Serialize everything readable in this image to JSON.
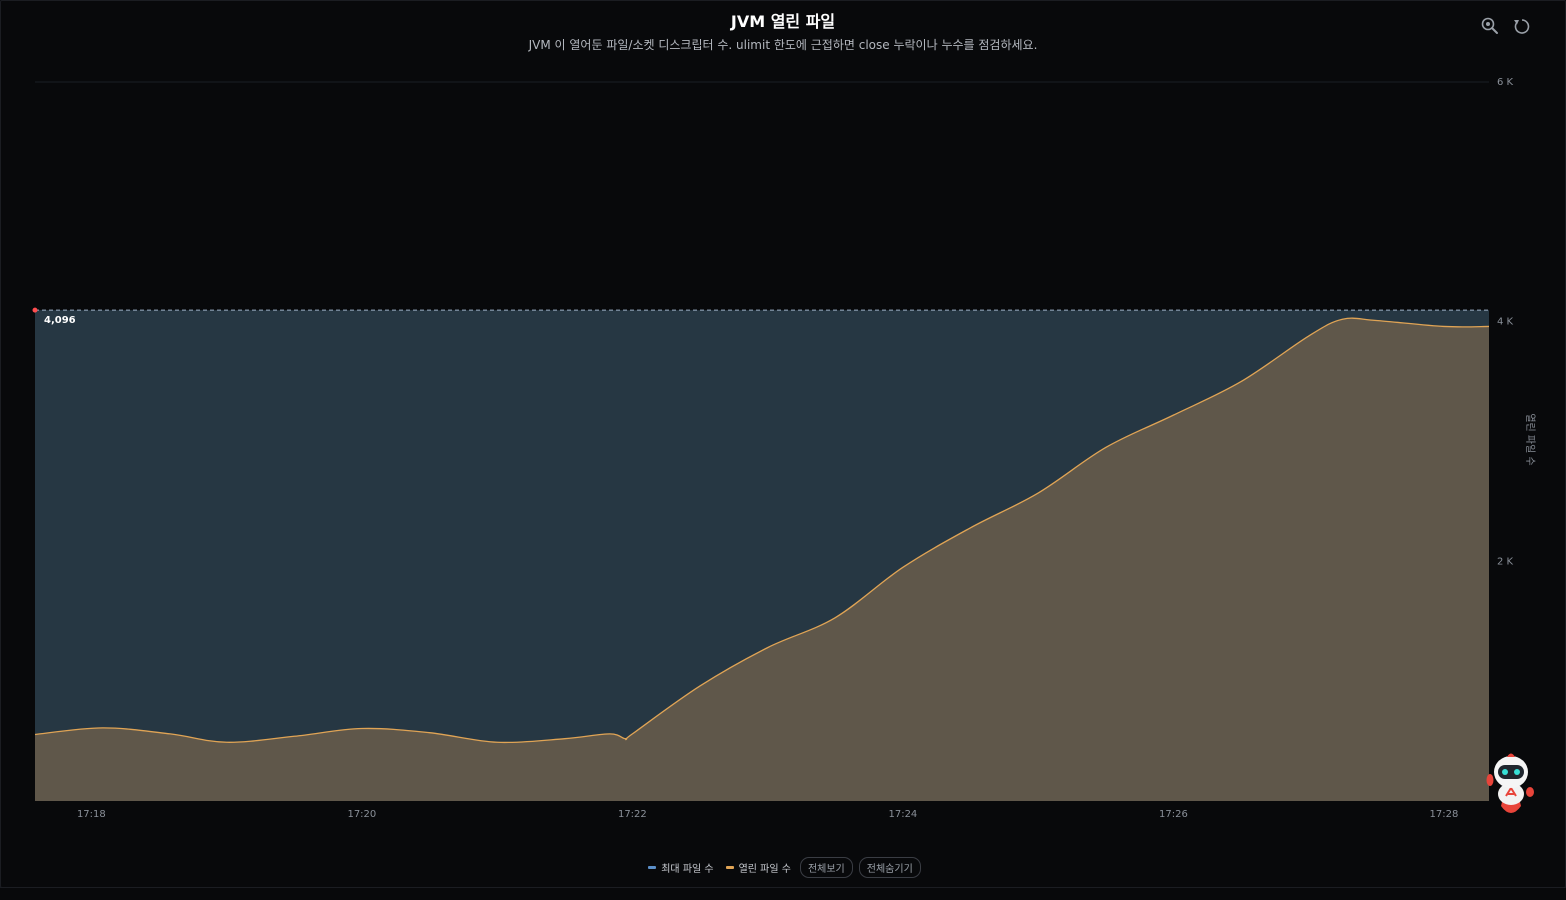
{
  "header": {
    "title": "JVM 열린 파일",
    "subtitle": "JVM 이 열어둔 파일/소켓 디스크립터 수. ulimit 한도에 근접하면 close 누락이나 누수를 점검하세요."
  },
  "toolbar": {
    "zoom_icon": "zoom-reset-icon",
    "restore_icon": "restore-icon"
  },
  "legend": {
    "items": [
      {
        "label": "최대 파일 수",
        "color": "#5b8fc9"
      },
      {
        "label": "열린 파일 수",
        "color": "#e0a455"
      }
    ],
    "show_all_label": "전체보기",
    "hide_all_label": "전체숨기기"
  },
  "chart_data": {
    "type": "area",
    "ylabel": "열린 파일 수",
    "ylim": [
      0,
      6000
    ],
    "y_ticks": [
      {
        "value": 2000,
        "label": "2 K"
      },
      {
        "value": 4000,
        "label": "4 K"
      },
      {
        "value": 6000,
        "label": "6 K"
      }
    ],
    "x_range": [
      "17:17:35",
      "17:28:20"
    ],
    "x_ticks": [
      "17:18",
      "17:20",
      "17:22",
      "17:24",
      "17:26",
      "17:28"
    ],
    "max_line_label": "4,096",
    "colors": {
      "max_line": "#9fb3c8",
      "max_fill": "#263743",
      "open_line": "#e0a455",
      "open_fill": "#5f574a",
      "marker": "#ff4d4f"
    },
    "series": [
      {
        "name": "최대 파일 수",
        "x": [
          "17:17:35",
          "17:28:20"
        ],
        "y": [
          4096,
          4096
        ]
      },
      {
        "name": "열린 파일 수",
        "x": [
          "17:17:35",
          "17:18:05",
          "17:18:35",
          "17:19:00",
          "17:19:30",
          "17:20:00",
          "17:20:30",
          "17:21:00",
          "17:21:30",
          "17:21:50",
          "17:21:57",
          "17:22:00",
          "17:22:30",
          "17:23:00",
          "17:23:30",
          "17:24:00",
          "17:24:30",
          "17:25:00",
          "17:25:30",
          "17:26:00",
          "17:26:30",
          "17:27:00",
          "17:27:15",
          "17:27:30",
          "17:28:00",
          "17:28:20"
        ],
        "y": [
          555,
          610,
          560,
          490,
          540,
          605,
          570,
          490,
          520,
          560,
          520,
          560,
          960,
          1280,
          1530,
          1950,
          2280,
          2570,
          2950,
          3220,
          3500,
          3880,
          4020,
          4010,
          3960,
          3960
        ]
      }
    ]
  }
}
